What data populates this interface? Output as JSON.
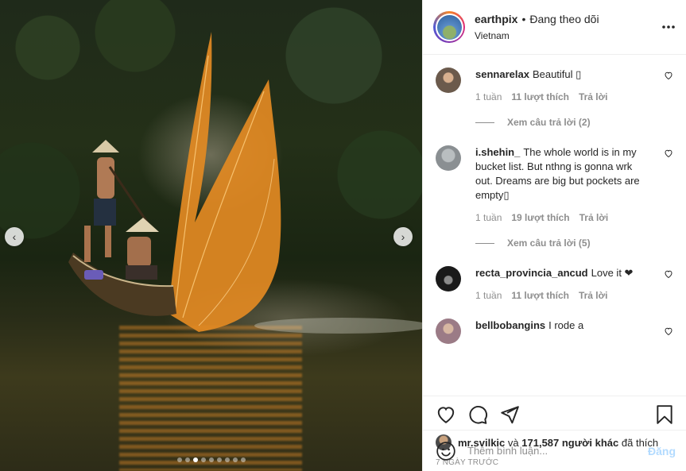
{
  "post": {
    "author": "earthpix",
    "separator": "•",
    "follow_status": "Đang theo dõi",
    "location": "Vietnam",
    "more_icon": "more-horizontal-icon"
  },
  "carousel": {
    "prev_icon": "‹",
    "next_icon": "›",
    "slide_count": 9,
    "active_slide": 3
  },
  "comments": [
    {
      "user": "sennarelax",
      "text": "Beautiful ▯",
      "time": "1 tuần",
      "likes": "11 lượt thích",
      "reply": "Trả lời",
      "view_replies": "Xem câu trả lời (2)",
      "avatar_color": "#6b5a4c"
    },
    {
      "user": "i.shehin_",
      "text": "The whole world is in my bucket list. But nthng is gonna wrk out. Dreams are big but pockets are empty▯",
      "time": "1 tuần",
      "likes": "19 lượt thích",
      "reply": "Trả lời",
      "view_replies": "Xem câu trả lời (5)",
      "avatar_color": "#8a8f92"
    },
    {
      "user": "recta_provincia_ancud",
      "text": "Love it ❤",
      "time": "1 tuần",
      "likes": "11 lượt thích",
      "reply": "Trả lời",
      "avatar_color": "#1a1a1a"
    },
    {
      "user": "bellbobangins",
      "text": "I rode a",
      "avatar_color": "#9b7b86"
    }
  ],
  "actions": {
    "like_icon": "heart-icon",
    "comment_icon": "comment-icon",
    "share_icon": "share-icon",
    "save_icon": "bookmark-icon"
  },
  "likes": {
    "user": "mr.svilkic",
    "conjunction": "và",
    "count": "171,587 người khác",
    "suffix": "đã thích"
  },
  "date": "7 NGÀY TRƯỚC",
  "add_comment": {
    "placeholder": "Thêm bình luận...",
    "post_label": "Đăng"
  }
}
